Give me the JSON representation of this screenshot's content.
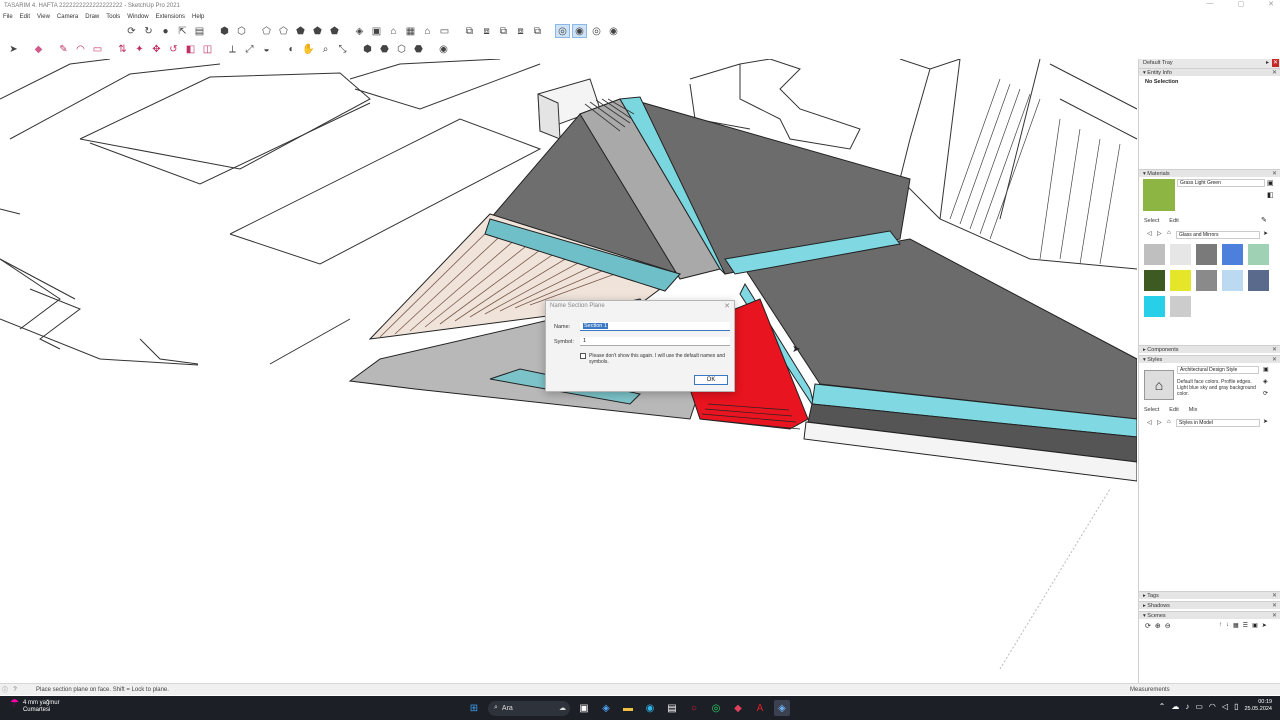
{
  "window": {
    "title": "TASARIM 4. HAFTA 2222222222222222222 - SketchUp Pro 2021",
    "controls": [
      "—",
      "▢",
      "✕"
    ]
  },
  "menu": [
    "File",
    "Edit",
    "View",
    "Camera",
    "Draw",
    "Tools",
    "Window",
    "Extensions",
    "Help"
  ],
  "dialog": {
    "title": "Name Section Plane",
    "name_label": "Name:",
    "name_value": "Section 1",
    "symbol_label": "Symbol:",
    "symbol_value": "1",
    "checkbox_label": "Please don't show this again. I will use the default names and symbols.",
    "ok_label": "OK"
  },
  "tray": {
    "title": "Default Tray",
    "entity_info": {
      "header": "Entity Info",
      "value": "No Selection"
    },
    "materials": {
      "header": "Materials",
      "current_name": "Grass Light Green",
      "current_color": "#8db544",
      "tab_select": "Select",
      "tab_edit": "Edit",
      "collection": "Glass and Mirrors",
      "swatches": [
        "#bfbfbf",
        "#e6e6e6",
        "#7a7a7a",
        "#4d7fdc",
        "#9fd1b5",
        "#3d5a23",
        "#e5e62a",
        "#8a8a8a",
        "#bcd9f2",
        "#5a6a8c",
        "#27d0e8",
        "#cccccc"
      ]
    },
    "components": {
      "header": "Components"
    },
    "styles": {
      "header": "Styles",
      "name": "Architectural Design Style",
      "description": "Default face colors. Profile edges. Light blue sky and gray background color.",
      "tab_select": "Select",
      "tab_edit": "Edit",
      "tab_mix": "Mix",
      "collection": "Styles in Model"
    },
    "tags": {
      "header": "Tags"
    },
    "shadows": {
      "header": "Shadows"
    },
    "scenes": {
      "header": "Scenes"
    }
  },
  "status": {
    "message": "Place section plane on face.  Shift = Lock to plane.",
    "measurements_label": "Measurements"
  },
  "taskbar": {
    "weather_temp": "4 mm yağmur",
    "weather_desc": "Cumartesi",
    "search_label": "Ara",
    "time": "00:19",
    "date": "25.05.2024"
  }
}
